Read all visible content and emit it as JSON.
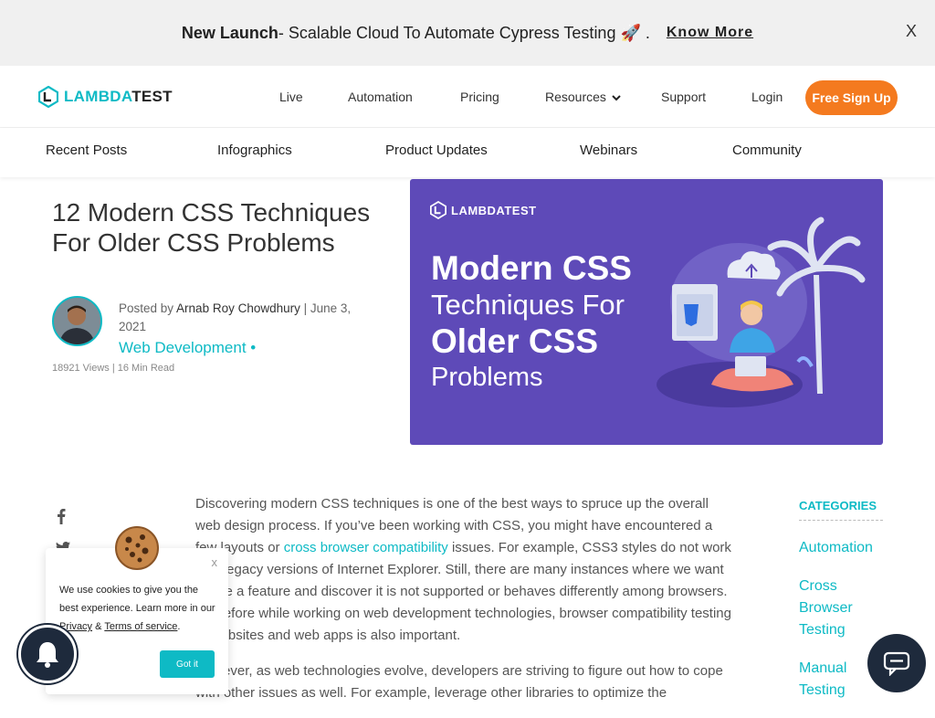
{
  "announcement": {
    "lead": "New Launch",
    "text": " - Scalable Cloud To Automate Cypress Testing 🚀 .",
    "cta": "Know More",
    "close": "X"
  },
  "header": {
    "logo_part1": "LAMBDA",
    "logo_part2": "TEST",
    "nav": {
      "live": "Live",
      "automation": "Automation",
      "pricing": "Pricing",
      "resources": "Resources",
      "support": "Support",
      "login": "Login"
    },
    "signup": "Free Sign Up"
  },
  "subnav": {
    "recent": "Recent Posts",
    "infographics": "Infographics",
    "updates": "Product Updates",
    "webinars": "Webinars",
    "community": "Community"
  },
  "article": {
    "title": "12 Modern CSS Techniques For Older CSS Problems",
    "posted_by": "Posted by ",
    "author": "Arnab Roy Chowdhury",
    "date": " | June 3, 2021",
    "category": "Web Development •",
    "meta": "18921 Views | 16 Min Read"
  },
  "hero": {
    "logo": "LAMBDATEST",
    "line1": "Modern CSS",
    "line2": "Techniques For",
    "line3": "Older CSS",
    "line4": "Problems"
  },
  "body": {
    "p1_a": "Discovering modern CSS techniques is one of the best ways to spruce up the overall web design process. If you’ve been working with CSS, you might have encountered a few layouts or ",
    "p1_link": "cross browser compatibility",
    "p1_b": " issues. For example, CSS3 styles do not work with legacy versions of Internet Explorer. Still, there are many instances where we want to use a feature and discover it is not supported or behaves differently among browsers. Therefore while working on web development technologies, browser compatibility testing of websites and web apps is also important.",
    "p2": "However, as web technologies evolve, developers are striving to figure out how to cope with other issues as well. For example, leverage other libraries to optimize the"
  },
  "categories": {
    "title": "CATEGORIES",
    "items": [
      "Automation",
      "Cross Browser Testing",
      "Manual Testing"
    ]
  },
  "cookie": {
    "close": "x",
    "text_a": "We use cookies to give you the best experience. Learn more in our ",
    "privacy": "Privacy",
    "amp": " & ",
    "terms": "Terms of service",
    "dot": ".",
    "button": "Got it"
  },
  "colors": {
    "brand_teal": "#0ebac5",
    "signup_orange": "#f47a1f",
    "hero_purple": "#5e4ab8",
    "float_dark": "#1e2a3c"
  }
}
